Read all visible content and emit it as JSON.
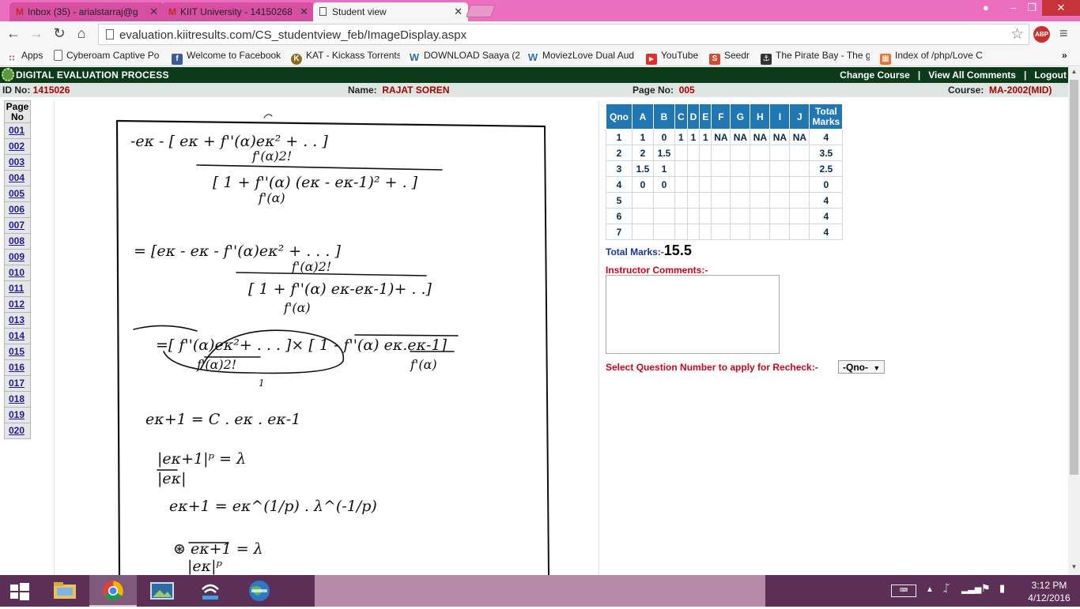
{
  "browser": {
    "tabs": [
      {
        "label": "Inbox (35) - arialstarraj@g",
        "icon": "gmail-icon"
      },
      {
        "label": "KIIT University - 14150268",
        "icon": "gmail-icon"
      },
      {
        "label": "Student view",
        "icon": "document-icon",
        "active": true
      }
    ],
    "url": "evaluation.kiitresults.com/CS_studentview_feb/ImageDisplay.aspx",
    "abp_label": "ABP",
    "bookmarks": [
      {
        "label": "Apps",
        "icon": "apps-grid-icon"
      },
      {
        "label": "Cyberoam Captive Po",
        "icon": "document-icon"
      },
      {
        "label": "Welcome to Facebook",
        "icon": "facebook-icon"
      },
      {
        "label": "KAT - Kickass Torrents",
        "icon": "kat-icon"
      },
      {
        "label": "DOWNLOAD Saaya (2",
        "icon": "w-icon"
      },
      {
        "label": "MoviezLove Dual Aud",
        "icon": "w-icon"
      },
      {
        "label": "YouTube",
        "icon": "youtube-icon"
      },
      {
        "label": "Seedr",
        "icon": "seedr-icon"
      },
      {
        "label": "The Pirate Bay - The g",
        "icon": "pirate-bay-icon"
      },
      {
        "label": "Index of /php/Love C",
        "icon": "index-icon"
      }
    ]
  },
  "app": {
    "title": "DIGITAL EVALUATION PROCESS",
    "nav": {
      "change_course": "Change Course",
      "view_comments": "View All Comments",
      "logout": "Logout",
      "separator": "|"
    },
    "info": {
      "id_label": "ID No:",
      "id_value": "1415026",
      "name_label": "Name:",
      "name_value": "RAJAT SOREN",
      "page_label": "Page No:",
      "page_value": "005",
      "course_label": "Course:",
      "course_value": "MA-2002(MID)"
    },
    "page_nav": {
      "header": [
        "Page",
        "No"
      ],
      "pages": [
        "001",
        "002",
        "003",
        "004",
        "005",
        "006",
        "007",
        "008",
        "009",
        "010",
        "011",
        "012",
        "013",
        "014",
        "015",
        "016",
        "017",
        "018",
        "019",
        "020"
      ]
    },
    "marks_table": {
      "headers": [
        "Qno",
        "A",
        "B",
        "C",
        "D",
        "E",
        "F",
        "G",
        "H",
        "I",
        "J"
      ],
      "total_header": [
        "Total",
        "Marks"
      ],
      "rows": [
        [
          "1",
          "1",
          "0",
          "1",
          "1",
          "1",
          "NA",
          "NA",
          "NA",
          "NA",
          "NA",
          "4"
        ],
        [
          "2",
          "2",
          "1.5",
          "",
          "",
          "",
          "",
          "",
          "",
          "",
          "",
          "3.5"
        ],
        [
          "3",
          "1.5",
          "1",
          "",
          "",
          "",
          "",
          "",
          "",
          "",
          "",
          "2.5"
        ],
        [
          "4",
          "0",
          "0",
          "",
          "",
          "",
          "",
          "",
          "",
          "",
          "",
          "0"
        ],
        [
          "5",
          "",
          "",
          "",
          "",
          "",
          "",
          "",
          "",
          "",
          "",
          "4"
        ],
        [
          "6",
          "",
          "",
          "",
          "",
          "",
          "",
          "",
          "",
          "",
          "",
          "4"
        ],
        [
          "7",
          "",
          "",
          "",
          "",
          "",
          "",
          "",
          "",
          "",
          "",
          "4"
        ]
      ]
    },
    "total_marks_label": "Total Marks:-",
    "total_marks_value": "15.5",
    "instructor_comments_label": "Instructor Comments:-",
    "instructor_comments_value": "",
    "recheck_label": "Select Question Number to apply for Recheck:-",
    "recheck_selected": "-Qno-"
  },
  "taskbar": {
    "clock_time": "3:12 PM",
    "clock_date": "4/12/2016",
    "apps": [
      "file-explorer-icon",
      "chrome-icon",
      "photos-icon",
      "wifi-hotspot-icon",
      "globe-app-icon"
    ]
  }
}
